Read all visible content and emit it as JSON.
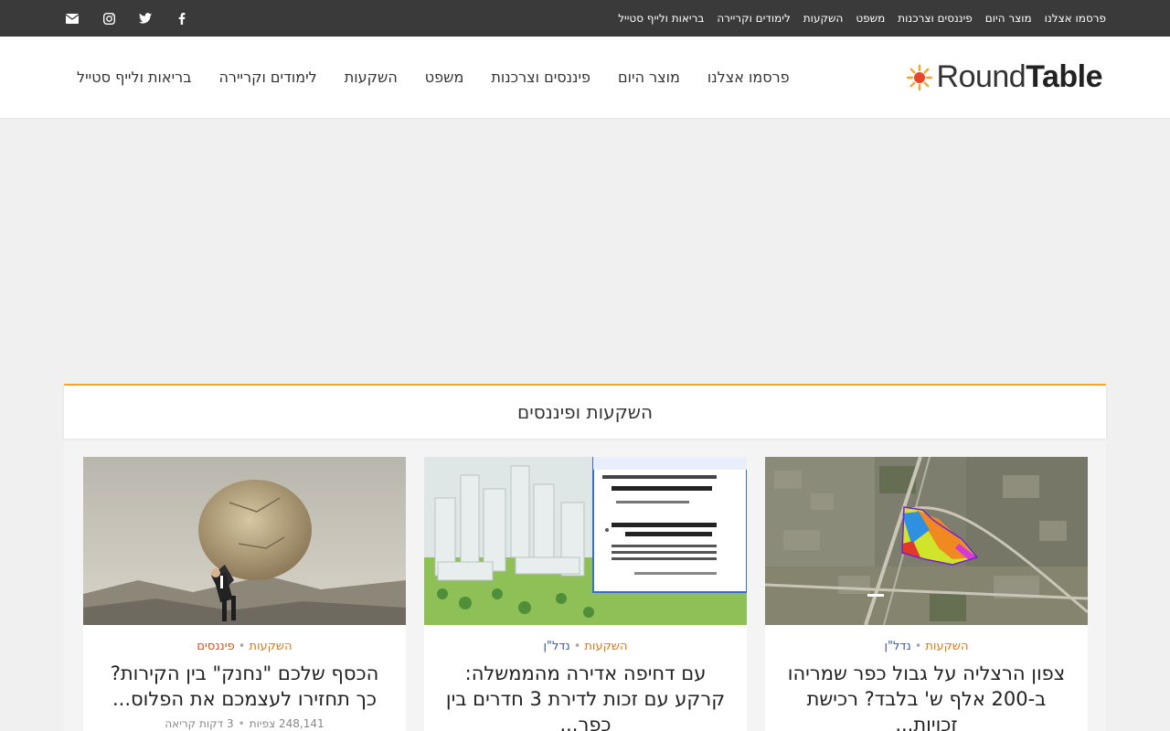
{
  "topbar": {
    "menu": [
      "בריאות ולייף סטייל",
      "לימודים וקריירה",
      "השקעות",
      "משפט",
      "פיננסים וצרכנות",
      "מוצר היום",
      "פרסמו אצלנו"
    ],
    "social_icons": [
      "facebook-icon",
      "twitter-icon",
      "instagram-icon",
      "email-icon"
    ]
  },
  "header": {
    "logo_light": "Round",
    "logo_bold": "Table",
    "nav": [
      "בריאות ולייף סטייל",
      "לימודים וקריירה",
      "השקעות",
      "משפט",
      "פיננסים וצרכנות",
      "מוצר היום",
      "פרסמו אצלנו"
    ]
  },
  "section": {
    "title": "השקעות ופיננסים",
    "cards": [
      {
        "cat1": "השקעות",
        "cat2": "נדל\"ן",
        "title": "צפון הרצליה על גבול כפר שמריהו ב-200 אלף ש' בלבד? רכישת זכויות..."
      },
      {
        "cat1": "השקעות",
        "cat2": "נדל\"ן",
        "title": "עם דחיפה אדירה מהממשלה: קרקע עם זכות לדירת 3 חדרים בין כפר..."
      },
      {
        "cat1": "השקעות",
        "cat2": "פיננסים",
        "title": "הכסף שלכם \"נחנק\" בין הקירות? כך תחזירו לעצמכם את הפלוס...",
        "views": "248,141 צפיות",
        "read": "3 דקות קריאה"
      }
    ]
  },
  "colors": {
    "accent": "#f5a623",
    "topbar": "#3a3a3a"
  }
}
